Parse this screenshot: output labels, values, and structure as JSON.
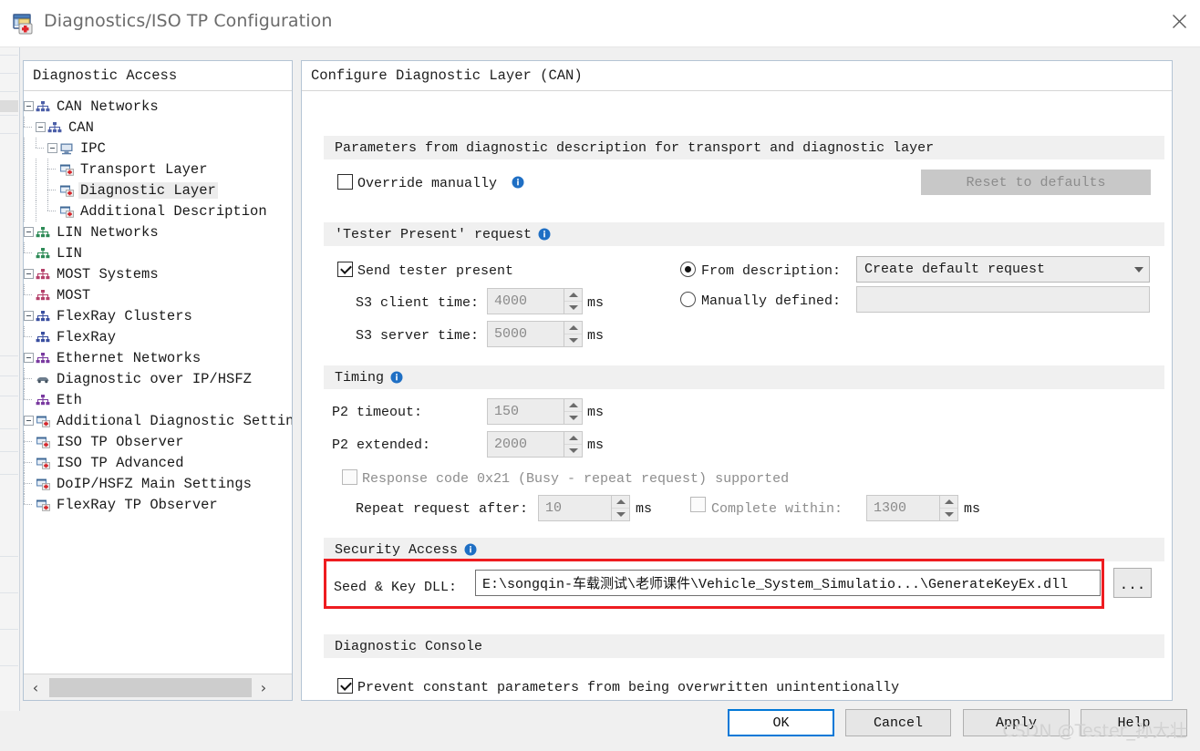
{
  "window": {
    "title": "Diagnostics/ISO TP Configuration",
    "icon": "diagnostics-config-icon",
    "close_icon": "close-icon"
  },
  "tree_panel": {
    "header": "Diagnostic Access",
    "nodes": [
      {
        "label": "CAN Networks",
        "depth": 0,
        "icon": "network-bus-icon",
        "expander": "collapse",
        "selected": false,
        "last": false
      },
      {
        "label": "CAN",
        "depth": 1,
        "icon": "network-bus-icon",
        "expander": "collapse",
        "selected": false,
        "last": true
      },
      {
        "label": "IPC",
        "depth": 2,
        "icon": "ecu-node-icon",
        "expander": "collapse",
        "selected": false,
        "last": true
      },
      {
        "label": "Transport Layer",
        "depth": 3,
        "icon": "diag-layer-icon",
        "expander": "none",
        "selected": false,
        "last": false
      },
      {
        "label": "Diagnostic Layer",
        "depth": 3,
        "icon": "diag-layer-icon",
        "expander": "none",
        "selected": true,
        "last": false
      },
      {
        "label": "Additional Description",
        "depth": 3,
        "icon": "diag-layer-icon",
        "expander": "none",
        "selected": false,
        "last": true
      },
      {
        "label": "LIN Networks",
        "depth": 0,
        "icon": "lin-bus-icon",
        "expander": "collapse",
        "selected": false,
        "last": false
      },
      {
        "label": "LIN",
        "depth": 1,
        "icon": "lin-bus-icon",
        "expander": "none",
        "selected": false,
        "last": true
      },
      {
        "label": "MOST Systems",
        "depth": 0,
        "icon": "most-bus-icon",
        "expander": "collapse",
        "selected": false,
        "last": false
      },
      {
        "label": "MOST",
        "depth": 1,
        "icon": "most-bus-icon",
        "expander": "none",
        "selected": false,
        "last": true
      },
      {
        "label": "FlexRay Clusters",
        "depth": 0,
        "icon": "flexray-bus-icon",
        "expander": "collapse",
        "selected": false,
        "last": false
      },
      {
        "label": "FlexRay",
        "depth": 1,
        "icon": "flexray-bus-icon",
        "expander": "none",
        "selected": false,
        "last": true
      },
      {
        "label": "Ethernet Networks",
        "depth": 0,
        "icon": "ethernet-bus-icon",
        "expander": "collapse",
        "selected": false,
        "last": false
      },
      {
        "label": "Diagnostic over IP/HSFZ",
        "depth": 1,
        "icon": "doip-vehicle-icon",
        "expander": "none",
        "selected": false,
        "last": false
      },
      {
        "label": "Eth",
        "depth": 1,
        "icon": "ethernet-bus-icon",
        "expander": "none",
        "selected": false,
        "last": true
      },
      {
        "label": "Additional Diagnostic Settings",
        "depth": 0,
        "icon": "additional-settings-icon",
        "expander": "collapse",
        "selected": false,
        "last": true
      },
      {
        "label": "ISO TP Observer",
        "depth": 1,
        "icon": "diag-layer-icon",
        "expander": "none",
        "selected": false,
        "last": false
      },
      {
        "label": "ISO TP Advanced",
        "depth": 1,
        "icon": "diag-layer-icon",
        "expander": "none",
        "selected": false,
        "last": false
      },
      {
        "label": "DoIP/HSFZ Main Settings",
        "depth": 1,
        "icon": "diag-layer-icon",
        "expander": "none",
        "selected": false,
        "last": false
      },
      {
        "label": "FlexRay TP Observer",
        "depth": 1,
        "icon": "diag-layer-icon",
        "expander": "none",
        "selected": false,
        "last": true
      }
    ],
    "scrollbar": {
      "left_arrow": "‹",
      "right_arrow": "›"
    }
  },
  "config_panel": {
    "header": "Configure Diagnostic Layer (CAN)",
    "groups": {
      "parameters": {
        "title": "Parameters from diagnostic description for transport and diagnostic layer",
        "override_manually_label": "Override manually",
        "override_manually_checked": false,
        "reset_button_label": "Reset to defaults",
        "reset_button_enabled": false
      },
      "tester_present": {
        "title": "'Tester Present' request",
        "send_tester_present_label": "Send tester present",
        "send_tester_present_checked": true,
        "s3_client_label": "S3 client time:",
        "s3_client_value": "4000",
        "s3_client_unit": "ms",
        "s3_server_label": "S3 server time:",
        "s3_server_value": "5000",
        "s3_server_unit": "ms",
        "from_description_label": "From description:",
        "from_description_selected": true,
        "from_description_value": "Create default request",
        "manually_defined_label": "Manually defined:",
        "manually_defined_selected": false,
        "manually_defined_value": ""
      },
      "timing": {
        "title": "Timing",
        "p2_timeout_label": "P2 timeout:",
        "p2_timeout_value": "150",
        "p2_timeout_unit": "ms",
        "p2_extended_label": "P2 extended:",
        "p2_extended_value": "2000",
        "p2_extended_unit": "ms",
        "response_code_label": "Response code 0x21 (Busy - repeat request) supported",
        "response_code_checked": false,
        "repeat_request_label": "Repeat request after:",
        "repeat_request_value": "10",
        "repeat_request_unit": "ms",
        "complete_within_label": "Complete within:",
        "complete_within_checked": false,
        "complete_within_value": "1300",
        "complete_within_unit": "ms"
      },
      "security_access": {
        "title": "Security Access",
        "seed_key_label": "Seed & Key DLL:",
        "seed_key_value": "E:\\songqin-车载测试\\老师课件\\Vehicle_System_Simulatio...\\GenerateKeyEx.dll",
        "browse_label": "...",
        "highlight_color": "#ee1c20"
      },
      "diagnostic_console": {
        "title": "Diagnostic Console",
        "prevent_label": "Prevent constant parameters from being overwritten unintentionally",
        "prevent_checked": true
      }
    }
  },
  "dialog_buttons": {
    "ok": "OK",
    "cancel": "Cancel",
    "apply": "Apply",
    "help": "Help"
  },
  "watermark": "CSDN @Tester_孙大壮"
}
